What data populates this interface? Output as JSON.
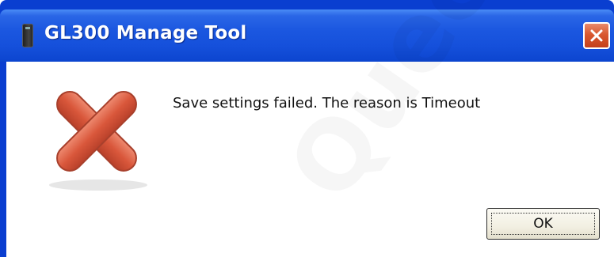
{
  "window": {
    "title": "GL300 Manage Tool",
    "icon": "app-device-icon",
    "close_icon": "close-icon"
  },
  "dialog": {
    "icon": "error-x-icon",
    "message": "Save settings failed. The reason is Timeout",
    "ok_label": "OK"
  },
  "watermark": {
    "text": "Queclink"
  },
  "colors": {
    "titlebar": "#1b57e0",
    "close_button": "#d9582f",
    "error_icon": "#d95a40"
  }
}
